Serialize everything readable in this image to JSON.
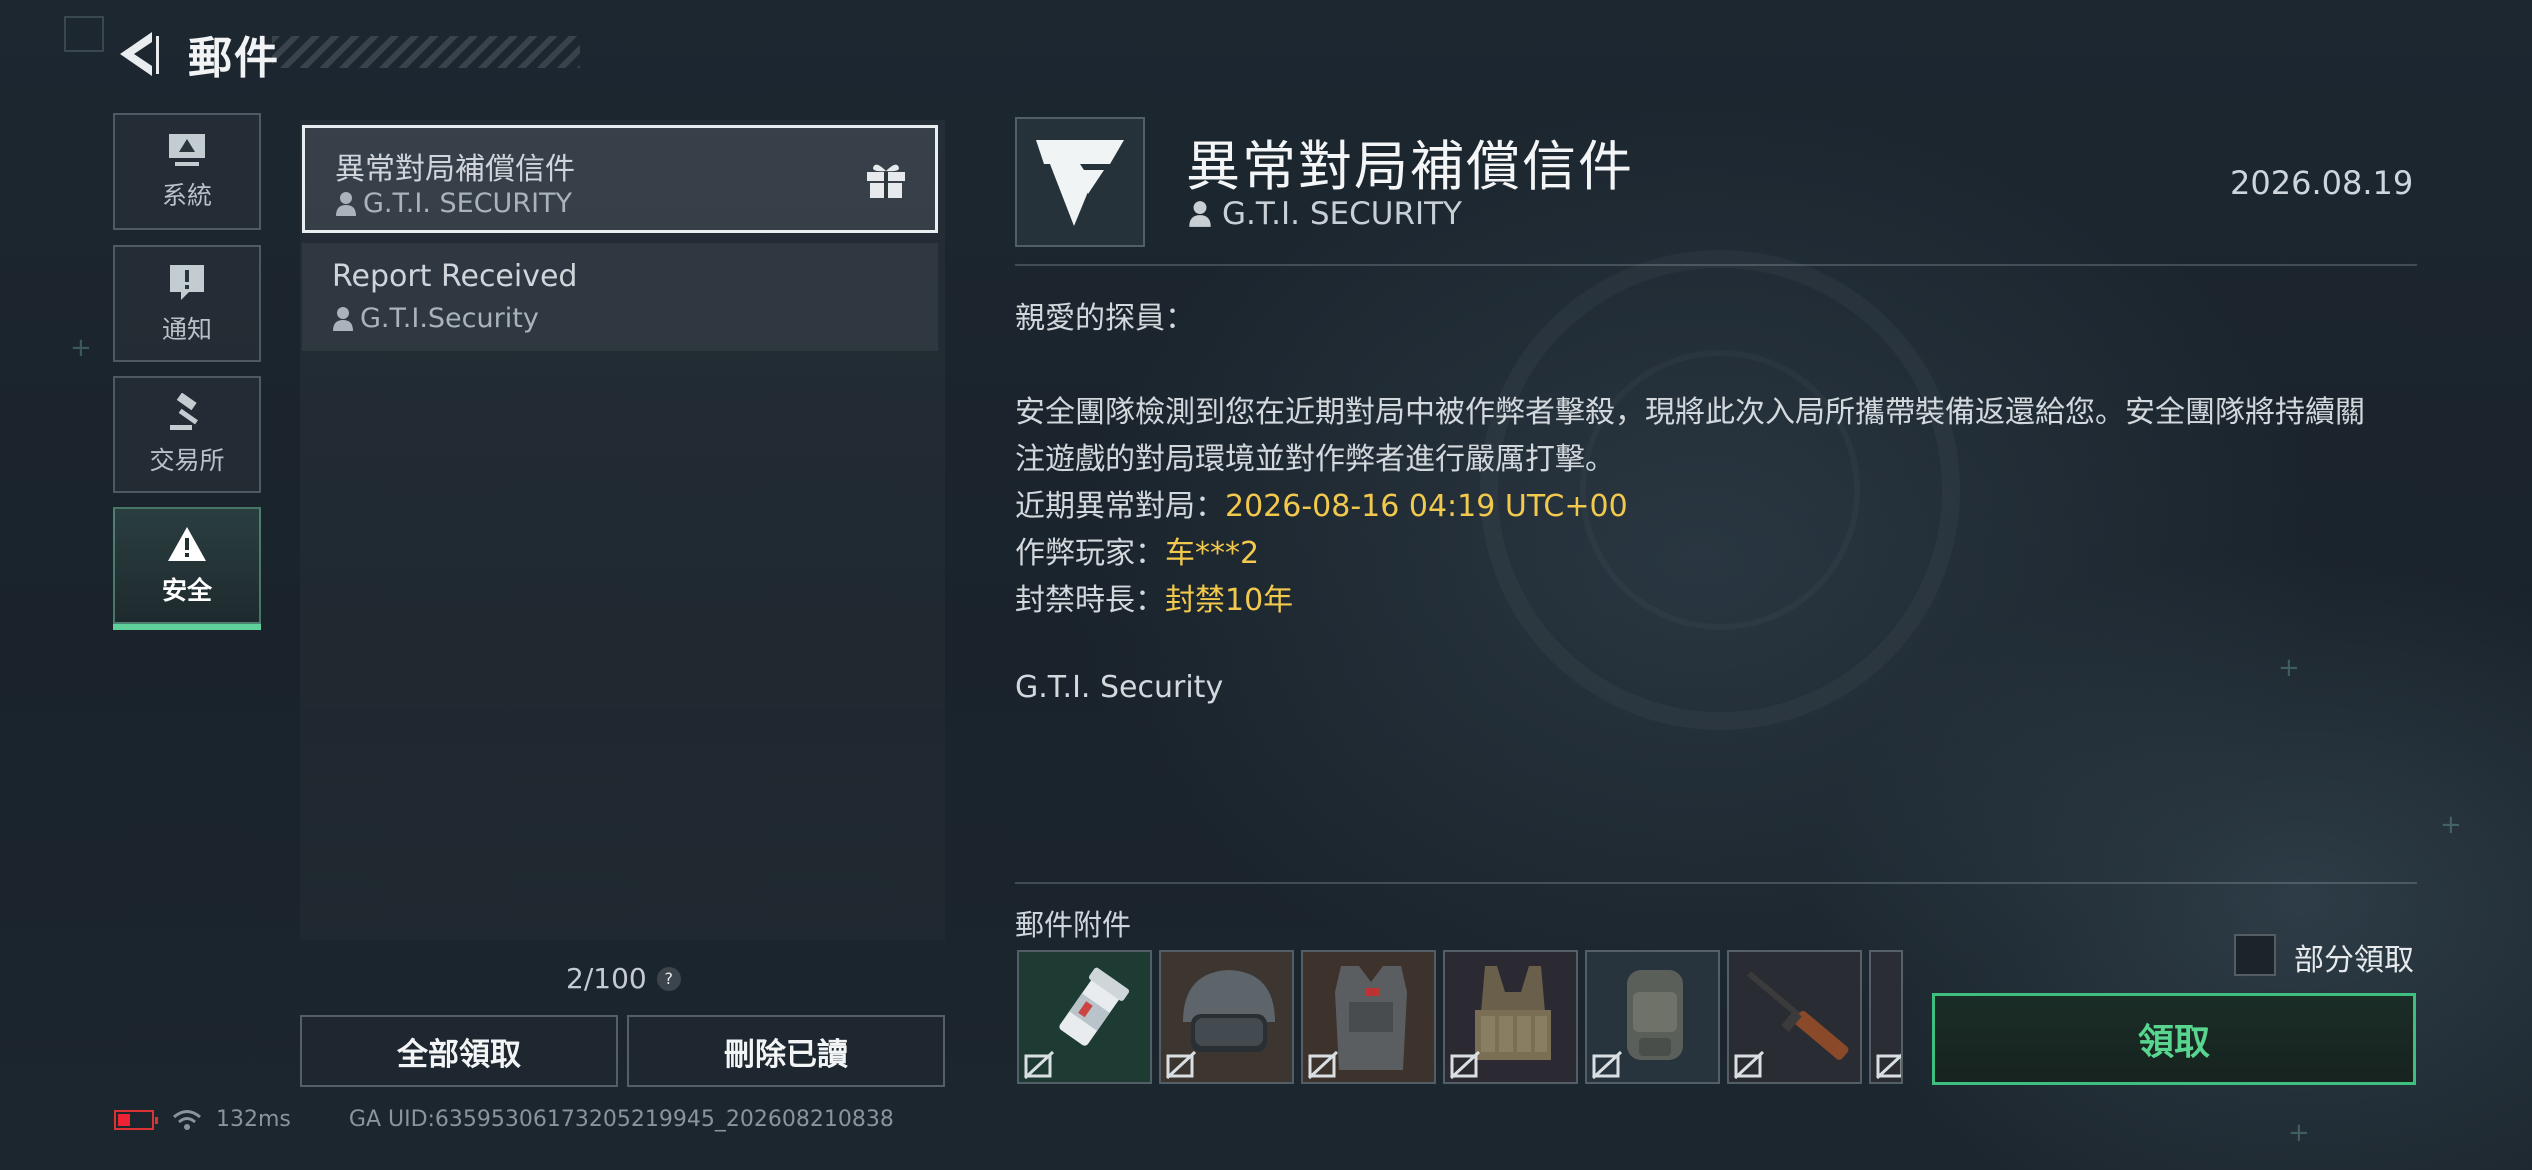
{
  "header": {
    "title": "郵件"
  },
  "categories": [
    {
      "label": "系統",
      "icon": "monitor-icon",
      "active": false
    },
    {
      "label": "通知",
      "icon": "alert-bubble-icon",
      "active": false
    },
    {
      "label": "交易所",
      "icon": "gavel-icon",
      "active": false
    },
    {
      "label": "安全",
      "icon": "warning-triangle-icon",
      "active": true
    }
  ],
  "mail_list": [
    {
      "subject": "異常對局補償信件",
      "sender": "G.T.I. SECURITY",
      "selected": true,
      "has_gift": true
    },
    {
      "subject": "Report Received",
      "sender": "G.T.I.Security",
      "selected": false,
      "has_gift": false
    }
  ],
  "list_footer": {
    "count": "2/100",
    "help": "?",
    "claim_all": "全部領取",
    "delete_read": "刪除已讀"
  },
  "status_bar": {
    "ping": "132ms",
    "uid": "GA UID:6359530617320521994​5_202608210838"
  },
  "detail": {
    "title": "異常對局補償信件",
    "sender": "G.T.I. SECURITY",
    "date": "2026.08.19",
    "greeting": "親愛的探員：",
    "body_line1": "安全團隊檢測到您在近期對局中被作弊者擊殺，現將此次入局所攜帶裝備返還給您。安全團隊將持續關",
    "body_line2": "注遊戲的對局環境並對作弊者進行嚴厲打擊。",
    "match_label": "近期異常對局：",
    "match_value": "2026-08-16 04:19 UTC+00",
    "cheater_label": "作弊玩家：",
    "cheater_value": "车***2",
    "ban_label": "封禁時長：",
    "ban_value": "封禁10年",
    "signature": "G.T.I. Security"
  },
  "attachments": {
    "label": "郵件附件",
    "items": [
      {
        "name": "pill-bottle",
        "color": "#1d3a33"
      },
      {
        "name": "tactical-helmet",
        "color": "#3c3530"
      },
      {
        "name": "armor-vest",
        "color": "#3d332c"
      },
      {
        "name": "chest-rig",
        "color": "#2b2a33"
      },
      {
        "name": "backpack",
        "color": "#27333d"
      },
      {
        "name": "rifle",
        "color": "#2a2c33"
      },
      {
        "name": "more-item",
        "color": "#2a2d33"
      }
    ],
    "partial_claim": "部分領取",
    "claim": "領取"
  },
  "colors": {
    "accent_green": "#3fbf7f",
    "highlight_yellow": "#f2c94c"
  }
}
